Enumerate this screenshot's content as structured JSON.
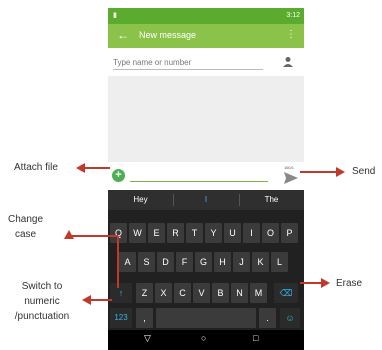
{
  "status_bar": {
    "time": "3:12"
  },
  "app_bar": {
    "back_glyph": "←",
    "title": "New message",
    "menu_glyph": "⋮"
  },
  "recipient": {
    "placeholder": "Type name or number"
  },
  "compose": {
    "attach_glyph": "+",
    "char_count": "160/1"
  },
  "keyboard": {
    "suggestions": [
      "Hey",
      "I",
      "The"
    ],
    "row1": [
      "Q",
      "W",
      "E",
      "R",
      "T",
      "Y",
      "U",
      "I",
      "O",
      "P"
    ],
    "row2": [
      "A",
      "S",
      "D",
      "F",
      "G",
      "H",
      "J",
      "K",
      "L"
    ],
    "row3": [
      "Z",
      "X",
      "C",
      "V",
      "B",
      "N",
      "M"
    ],
    "shift_glyph": "↑",
    "backspace_glyph": "⌫",
    "numeric_label": "123",
    "comma": ",",
    "period": ".",
    "emoji_glyph": "☺"
  },
  "nav_bar": {
    "back": "▽",
    "home": "○",
    "recents": "□"
  },
  "callouts": {
    "attach": "Attach file",
    "send": "Send",
    "case_line1": "Change",
    "case_line2": "case",
    "numeric_line1": "Switch to",
    "numeric_line2": "numeric",
    "numeric_line3": "/punctuation",
    "erase": "Erase"
  },
  "colors": {
    "status": "#5aab2e",
    "appbar": "#8bc34a",
    "callout_arrow": "#c0392b"
  }
}
